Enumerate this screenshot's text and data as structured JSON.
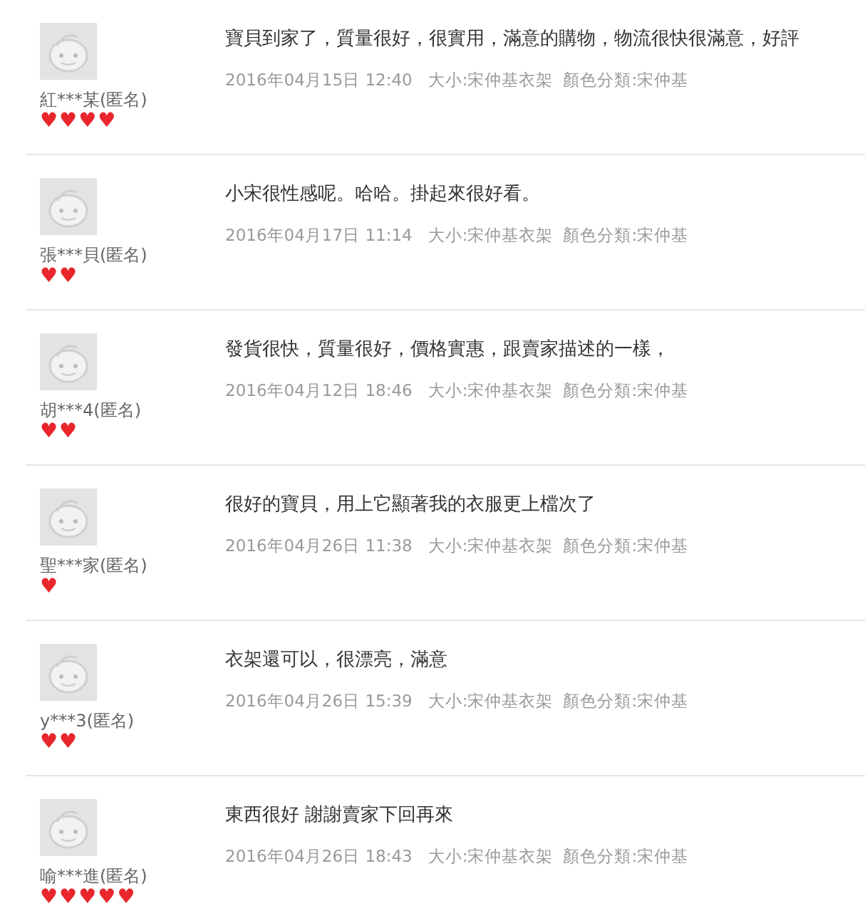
{
  "reviews": [
    {
      "user": "紅***某(匿名)",
      "credit_hearts": "♥♥♥♥",
      "comment": "寶貝到家了，質量很好，很實用，滿意的購物，物流很快很滿意，好評",
      "date": "2016年04月15日 12:40",
      "size": "大小:宋仲基衣架",
      "color_category": "顏色分類:宋仲基"
    },
    {
      "user": "張***貝(匿名)",
      "credit_hearts": "♥♥",
      "comment": "小宋很性感呢。哈哈。掛起來很好看。",
      "date": "2016年04月17日 11:14",
      "size": "大小:宋仲基衣架",
      "color_category": "顏色分類:宋仲基"
    },
    {
      "user": "胡***4(匿名)",
      "credit_hearts": "♥♥",
      "comment": "發貨很快，質量很好，價格實惠，跟賣家描述的一樣，",
      "date": "2016年04月12日 18:46",
      "size": "大小:宋仲基衣架",
      "color_category": "顏色分類:宋仲基"
    },
    {
      "user": "聖***家(匿名)",
      "credit_hearts": "♥",
      "comment": "很好的寶貝，用上它顯著我的衣服更上檔次了",
      "date": "2016年04月26日 11:38",
      "size": "大小:宋仲基衣架",
      "color_category": "顏色分類:宋仲基"
    },
    {
      "user": "y***3(匿名)",
      "credit_hearts": "♥♥",
      "comment": "衣架還可以，很漂亮，滿意",
      "date": "2016年04月26日 15:39",
      "size": "大小:宋仲基衣架",
      "color_category": "顏色分類:宋仲基"
    },
    {
      "user": "喻***進(匿名)",
      "credit_hearts": "♥♥♥♥♥",
      "comment": "東西很好 謝謝賣家下回再來",
      "date": "2016年04月26日 18:43",
      "size": "大小:宋仲基衣架",
      "color_category": "顏色分類:宋仲基"
    }
  ]
}
